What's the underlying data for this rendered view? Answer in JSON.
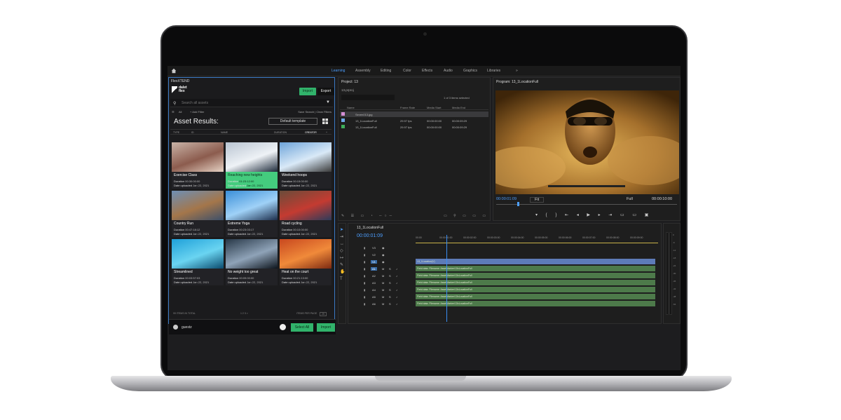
{
  "topbar": {
    "workspaces": [
      "Learning",
      "Assembly",
      "Editing",
      "Color",
      "Effects",
      "Audio",
      "Graphics",
      "Libraries"
    ],
    "active_workspace": "Learning",
    "more": "»"
  },
  "plugin": {
    "panel_title": "FlexXTEND",
    "logo_text": "dalet flex",
    "import_tab": "Import",
    "export_tab": "Export",
    "search_placeholder": "Search all assets",
    "filter_all": "All",
    "add_filter": "+ Add Filter",
    "save_clear": "Save Search | Clear Filters",
    "heading": "Asset Results:",
    "template": "Default template",
    "columns": [
      "TYPE",
      "ID",
      "NAME",
      "DURATION",
      "CREATOR"
    ],
    "cards": [
      {
        "name": "Exercise Class",
        "duration_label": "Duration",
        "duration": "00:30:00:00",
        "date_label": "Date uploaded",
        "date": "Jan 22, 2021",
        "selected": false
      },
      {
        "name": "Reaching new heights",
        "duration_label": "Duration",
        "duration": "01:23:12:00",
        "date_label": "Date uploaded",
        "date": "Jan 22, 2021",
        "selected": true
      },
      {
        "name": "Weekend hoops",
        "duration_label": "Duration",
        "duration": "00:15:00:00",
        "date_label": "Date uploaded",
        "date": "Jan 22, 2021",
        "selected": false
      },
      {
        "name": "Country Run",
        "duration_label": "Duration",
        "duration": "00:47:18:12",
        "date_label": "Date uploaded",
        "date": "Jan 22, 2021",
        "selected": false
      },
      {
        "name": "Extreme Yoga",
        "duration_label": "Duration",
        "duration": "00:23:03:17",
        "date_label": "Date uploaded",
        "date": "Jan 22, 2021",
        "selected": false
      },
      {
        "name": "Road cycling",
        "duration_label": "Duration",
        "duration": "00:10:00:00",
        "date_label": "Date uploaded",
        "date": "Jan 22, 2021",
        "selected": false
      },
      {
        "name": "Streamlined",
        "duration_label": "Duration",
        "duration": "00:03:57:03",
        "date_label": "Date uploaded",
        "date": "Jan 22, 2021",
        "selected": false
      },
      {
        "name": "No weight too great",
        "duration_label": "Duration",
        "duration": "00:09:00:00",
        "date_label": "Date uploaded",
        "date": "Jan 22, 2021",
        "selected": false
      },
      {
        "name": "Heat on the court",
        "duration_label": "Duration",
        "duration": "00:21:13:00",
        "date_label": "Date uploaded",
        "date": "Jan 22, 2021",
        "selected": false
      }
    ],
    "total": "99 ITEMS IN TOTAL",
    "pages": "1  2  3  >",
    "items_per_page_label": "ITEMS PER PAGE",
    "items_per_page": "25",
    "user": "guestz",
    "select_all": "Select All",
    "import_btn": "Import"
  },
  "project": {
    "title": "Project: 13",
    "file": "13.prproj",
    "selection": "1 of 3 items selected",
    "columns": [
      "Name",
      "Frame Rate",
      "Media Start",
      "Media End"
    ],
    "rows": [
      {
        "name": "Seven013.jpg",
        "rate": "",
        "start": "",
        "end": "",
        "color": "#d58fd5"
      },
      {
        "name": "13_1LocationFull",
        "rate": "29.97 fps",
        "start": "00:00:00:00",
        "end": "00:00:09:29",
        "color": "#6da7e8"
      },
      {
        "name": "13_1LocationFull",
        "rate": "29.97 fps",
        "start": "00:00:00:00",
        "end": "00:00:09:29",
        "color": "#3fae5a"
      }
    ]
  },
  "program": {
    "title": "Program: 13_1LocationFull",
    "current_tc": "00:00:01:09",
    "fit": "Fit",
    "quality": "Full",
    "duration_tc": "00:00:10:00"
  },
  "timeline": {
    "title": "13_1LocationFull",
    "tc": "00:00:01:09",
    "ruler": [
      "00:00",
      "00:00:01:00",
      "00:00:02:00",
      "00:00:03:00",
      "00:00:04:00",
      "00:00:05:00",
      "00:00:06:00",
      "00:00:07:00",
      "00:00:08:00",
      "00:00:09:00"
    ],
    "video_tracks": [
      "V3",
      "V2",
      "V1"
    ],
    "audio_tracks": [
      "A1",
      "A2",
      "A3",
      "A4",
      "A5",
      "A6"
    ],
    "video_clip": "13_1Location(V)",
    "audio_clip": "Field data: Filename: AssetMarker/13xLocationFull"
  },
  "meters": {
    "labels": [
      "0",
      "-6",
      "-12",
      "-18",
      "-24",
      "-30",
      "-36",
      "-42",
      "-48",
      "-54"
    ]
  }
}
